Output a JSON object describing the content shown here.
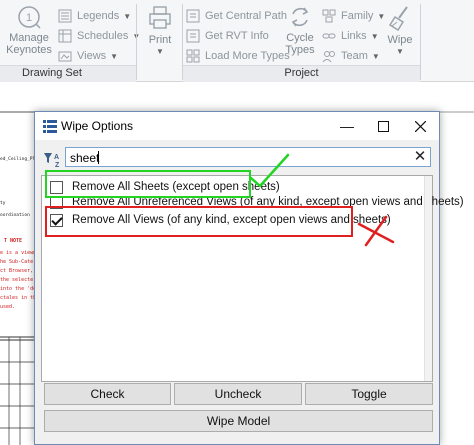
{
  "ribbon": {
    "drawing_set_group": {
      "label": "Drawing Set",
      "manage_keynotes": "Manage\nKeynotes",
      "legends": "Legends",
      "schedules": "Schedules",
      "views": "Views"
    },
    "print_group": {
      "print": "Print"
    },
    "project_group": {
      "label": "Project",
      "get_central_path": "Get Central Path",
      "get_rvt_info": "Get RVT Info",
      "load_more_types": "Load More Types",
      "cycle_types": "Cycle\nTypes",
      "family": "Family",
      "links": "Links",
      "team": "Team",
      "wipe": "Wipe"
    }
  },
  "background": {
    "left_text": [
      "ed_Ceiling_Plan",
      "ty",
      "oordination"
    ],
    "notes_heading": "T NOTE",
    "notes_lines": [
      "e is a viewm",
      "he Sub-Cate",
      "ct Browser,",
      "the selecte",
      "into the 'de",
      "ctales in the",
      "used."
    ]
  },
  "dialog": {
    "title": "Wipe Options",
    "search_value": "sheet",
    "items": [
      {
        "label": "Remove All Sheets (except open sheets)",
        "checked": false
      },
      {
        "label": "Remove All Unreferenced Views (of any kind, except open views and sheets)",
        "checked": false
      },
      {
        "label": "Remove All Views (of any kind, except open views and sheets)",
        "checked": true
      }
    ],
    "buttons": {
      "check": "Check",
      "uncheck": "Uncheck",
      "toggle": "Toggle",
      "wipe_model": "Wipe Model"
    }
  },
  "colors": {
    "green_annotation": "#22d522",
    "red_annotation": "#e02020",
    "dialog_border": "#6d8bb3"
  },
  "icons": [
    "manage-keynotes-icon",
    "legends-icon",
    "schedules-icon",
    "views-icon",
    "print-icon",
    "get-central-path-icon",
    "get-rvt-info-icon",
    "load-more-types-icon",
    "cycle-types-icon",
    "family-icon",
    "links-icon",
    "team-icon",
    "wipe-icon",
    "window-icon",
    "filter-sort-icon",
    "clear-icon",
    "minimize-icon",
    "maximize-icon",
    "close-icon"
  ]
}
